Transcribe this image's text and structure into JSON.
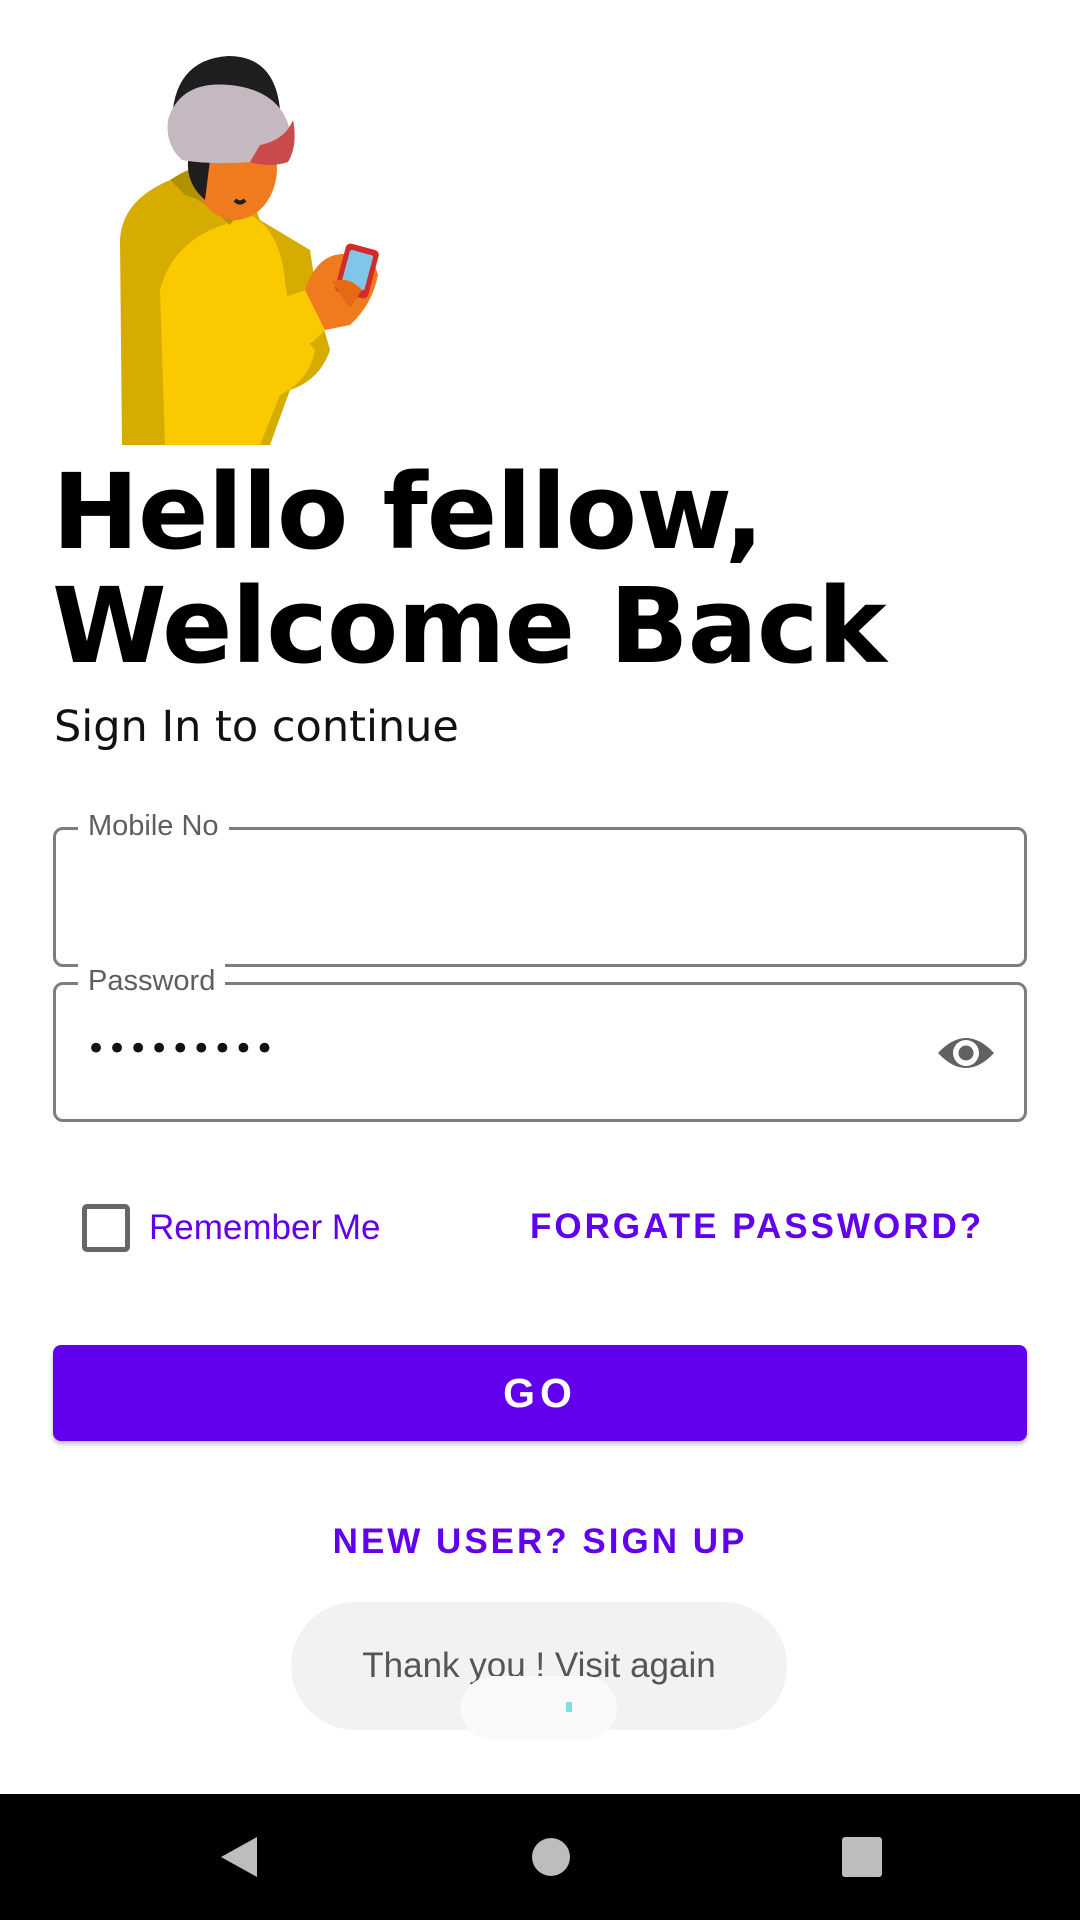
{
  "header": {
    "title_line1": "Hello fellow,",
    "title_line2": "Welcome Back",
    "subtitle": "Sign In to continue"
  },
  "form": {
    "mobile": {
      "label": "Mobile No",
      "value": ""
    },
    "password": {
      "label": "Password",
      "value": "•••••••••"
    },
    "remember_label": "Remember Me",
    "remember_checked": false,
    "forgot_label": "FORGATE PASSWORD?",
    "submit_label": "GO",
    "signup_label": "NEW USER? SIGN UP"
  },
  "toast": {
    "message": "Thank you ! Visit again"
  },
  "icons": {
    "illustration": "man-holding-phone-illustration",
    "password_toggle": "eye-icon",
    "nav_back": "back-triangle-icon",
    "nav_home": "home-circle-icon",
    "nav_recents": "recents-square-icon"
  },
  "colors": {
    "accent": "#6200ee",
    "field_border": "#7d7d7d",
    "toast_bg": "#f2f2f2",
    "navbar_bg": "#000000"
  }
}
